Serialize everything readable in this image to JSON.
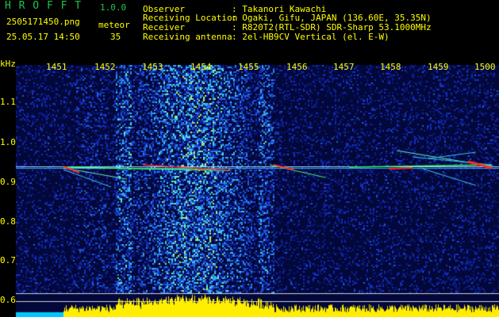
{
  "header": {
    "app_name": "H R O F F T",
    "version": "1.0.0",
    "filename": "2505171450.png",
    "detection_label": "meteor",
    "timestamp": "25.05.17 14:50",
    "detection_count": "35",
    "observer_label": "Observer",
    "observer_value": ": Takanori Kawachi",
    "location_label": "Receiving Location",
    "location_value": ": Ogaki, Gifu, JAPAN (136.60E, 35.35N)",
    "receiver_label": "Receiver",
    "receiver_value": ": R820T2(RTL-SDR) SDR-Sharp 53.1000MHz",
    "antenna_label": "Receiving antenna",
    "antenna_value": ": 2el-HB9CV Vertical (el. E-W)"
  },
  "axis": {
    "unit": "kHz",
    "x_ticks": [
      "1451",
      "1452",
      "1453",
      "1454",
      "1455",
      "1456",
      "1457",
      "1458",
      "1459",
      "1500"
    ],
    "y_ticks": [
      "1.1",
      "1.0",
      "0.9",
      "0.8",
      "0.7",
      "0.6"
    ]
  },
  "colors": {
    "header_text": "#ffff00",
    "app_name": "#21c44a",
    "background": "#000000",
    "noise_blue": "#1a2fb8",
    "trace_hot": "#ff2a2a",
    "trace_green": "#3cff6a",
    "bottom_bar": "#ffee00"
  }
}
